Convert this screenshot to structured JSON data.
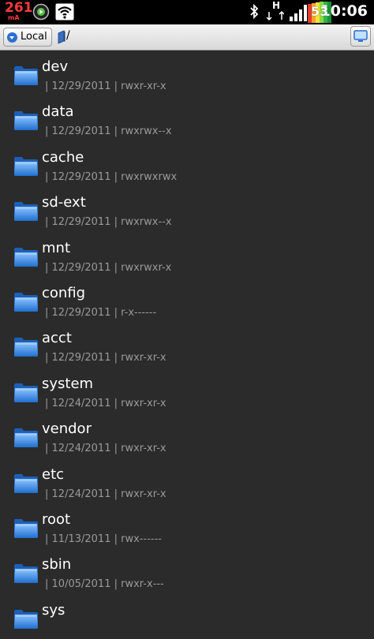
{
  "status_bar": {
    "battery_current": "261",
    "battery_unit": "mA",
    "network_type": "H",
    "battery_level": "53",
    "time": "10:06",
    "icons": [
      "circle-play-icon",
      "wifi-icon",
      "bluetooth-icon",
      "signal-icon",
      "battery-icon"
    ]
  },
  "path_bar": {
    "location_label": "Local",
    "path": "/",
    "view_icon": "monitor-icon"
  },
  "files": [
    {
      "name": "dev",
      "date": "12/29/2011",
      "perms": "rwxr-xr-x"
    },
    {
      "name": "data",
      "date": "12/29/2011",
      "perms": "rwxrwx--x"
    },
    {
      "name": "cache",
      "date": "12/29/2011",
      "perms": "rwxrwxrwx"
    },
    {
      "name": "sd-ext",
      "date": "12/29/2011",
      "perms": "rwxrwx--x"
    },
    {
      "name": "mnt",
      "date": "12/29/2011",
      "perms": "rwxrwxr-x"
    },
    {
      "name": "config",
      "date": "12/29/2011",
      "perms": "r-x------"
    },
    {
      "name": "acct",
      "date": "12/29/2011",
      "perms": "rwxr-xr-x"
    },
    {
      "name": "system",
      "date": "12/24/2011",
      "perms": "rwxr-xr-x"
    },
    {
      "name": "vendor",
      "date": "12/24/2011",
      "perms": "rwxr-xr-x"
    },
    {
      "name": "etc",
      "date": "12/24/2011",
      "perms": "rwxr-xr-x"
    },
    {
      "name": "root",
      "date": "11/13/2011",
      "perms": "rwx------"
    },
    {
      "name": "sbin",
      "date": "10/05/2011",
      "perms": "rwxr-x---"
    },
    {
      "name": "sys",
      "date": "",
      "perms": ""
    }
  ],
  "meta_separator": "|",
  "colors": {
    "background": "#2b2b2b",
    "folder_blue": "#3a86d8",
    "meta_text": "#9a9a9a",
    "battery_red": "#ff3b3b"
  }
}
